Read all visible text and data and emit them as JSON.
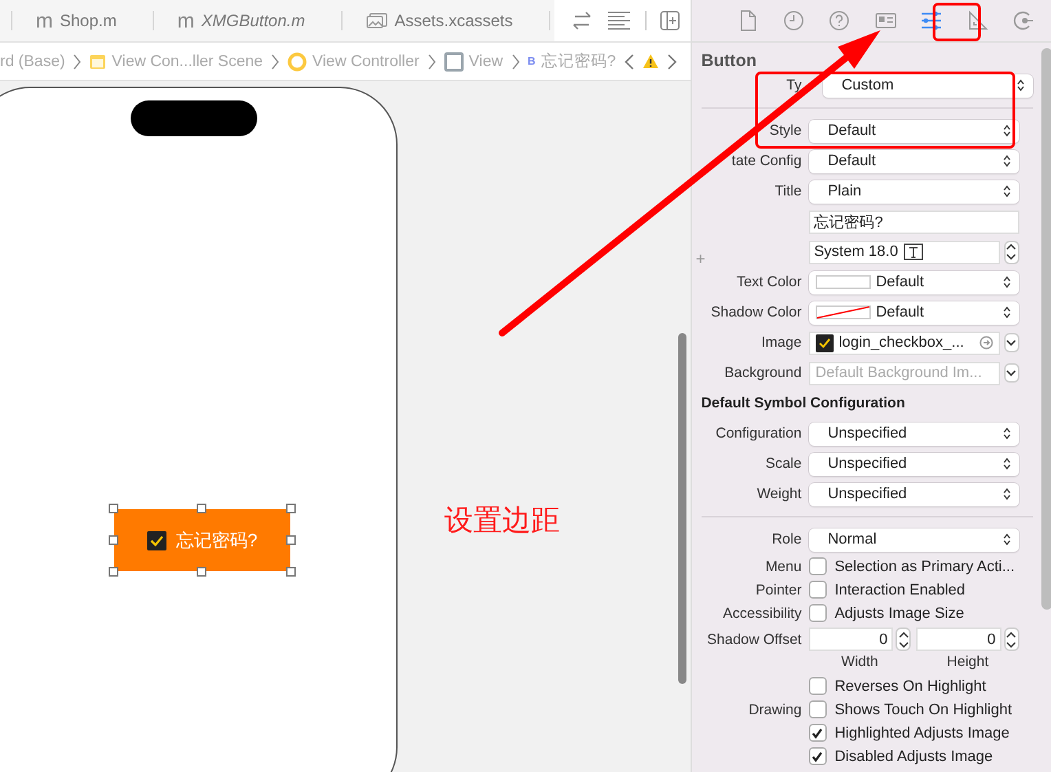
{
  "tabs": [
    {
      "kind": "source",
      "glyph": "m",
      "label": "Shop.m",
      "italic": false
    },
    {
      "kind": "source",
      "glyph": "m",
      "label": "XMGButton.m",
      "italic": true
    },
    {
      "kind": "assets",
      "label": "Assets.xcassets",
      "italic": false
    }
  ],
  "breadcrumb": [
    {
      "kind": "plain",
      "label": "rd (Base)"
    },
    {
      "kind": "scene",
      "label": "View Con...ller Scene"
    },
    {
      "kind": "controller",
      "label": "View Controller"
    },
    {
      "kind": "view",
      "label": "View"
    },
    {
      "kind": "button",
      "glyph": "B",
      "label": "忘记密码?"
    }
  ],
  "canvas": {
    "button": {
      "title": "忘记密码?",
      "checked": true
    },
    "annotation": "设置边距"
  },
  "inspector_tabs": [
    {
      "kind": "file",
      "selected": false
    },
    {
      "kind": "history",
      "selected": false
    },
    {
      "kind": "help",
      "selected": false
    },
    {
      "kind": "identity",
      "selected": false
    },
    {
      "kind": "attributes",
      "selected": true
    },
    {
      "kind": "size",
      "selected": false
    },
    {
      "kind": "connections",
      "selected": false
    }
  ],
  "inspector": {
    "title": "Button",
    "rows": [
      {
        "kind": "popup",
        "label": "Ty",
        "value": "Custom"
      },
      {
        "kind": "divider"
      },
      {
        "kind": "popup",
        "label": "Style",
        "value": "Default"
      },
      {
        "kind": "popup",
        "label": "tate Config",
        "value": "Default"
      },
      {
        "kind": "popup",
        "label": "Title",
        "value": "Plain"
      },
      {
        "kind": "text",
        "value": "忘记密码?"
      },
      {
        "kind": "font",
        "glyph": "+",
        "value": "System 18.0"
      },
      {
        "kind": "color",
        "label": "Text Color",
        "value": "Default",
        "clear": false
      },
      {
        "kind": "color",
        "label": "Shadow Color",
        "value": "Default",
        "clear": true
      },
      {
        "kind": "image",
        "label": "Image",
        "value": "login_checkbox_..."
      },
      {
        "kind": "image",
        "label": "Background",
        "placeholder": "Default Background Im..."
      },
      {
        "kind": "heading",
        "label": "Default Symbol Configuration"
      },
      {
        "kind": "popup",
        "label": "Configuration",
        "value": "Unspecified"
      },
      {
        "kind": "popup",
        "label": "Scale",
        "value": "Unspecified"
      },
      {
        "kind": "popup",
        "label": "Weight",
        "value": "Unspecified"
      },
      {
        "kind": "divider"
      },
      {
        "kind": "popup",
        "label": "Role",
        "value": "Normal"
      },
      {
        "kind": "checkbox",
        "label": "Menu",
        "text": "Selection as Primary Acti...",
        "checked": false
      },
      {
        "kind": "checkbox",
        "label": "Pointer",
        "text": "Interaction Enabled",
        "checked": false
      },
      {
        "kind": "checkbox",
        "label": "Accessibility",
        "text": "Adjusts Image Size",
        "checked": false
      },
      {
        "kind": "offset",
        "label": "Shadow Offset",
        "fields": [
          {
            "value": "0",
            "caption": "Width"
          },
          {
            "value": "0",
            "caption": "Height"
          }
        ]
      },
      {
        "kind": "checkbox",
        "text": "Reverses On Highlight",
        "checked": false
      },
      {
        "kind": "checkbox",
        "label": "Drawing",
        "text": "Shows Touch On Highlight",
        "checked": false
      },
      {
        "kind": "checkbox",
        "text": "Highlighted Adjusts Image",
        "checked": true
      },
      {
        "kind": "checkbox",
        "text": "Disabled Adjusts Image",
        "checked": true
      }
    ]
  }
}
